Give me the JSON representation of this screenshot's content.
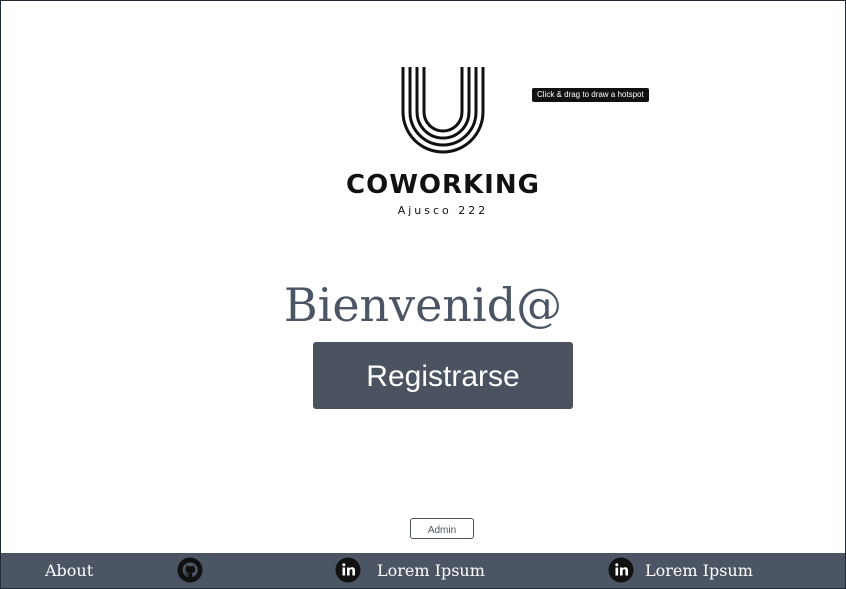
{
  "logo": {
    "word": "COWORKING",
    "subtitle": "Ajusco 222"
  },
  "tooltip": {
    "text": "Click & drag to draw a hotspot"
  },
  "main": {
    "welcome": "Bienvenid@",
    "register_label": "Registrarse",
    "admin_label": "Admin"
  },
  "footer": {
    "about_label": "About",
    "link1_label": "Lorem Ipsum",
    "link2_label": "Lorem Ipsum",
    "icons": [
      "github-icon",
      "linkedin-icon",
      "linkedin-icon"
    ],
    "background": "#4b5563"
  },
  "colors": {
    "button": "#4b5260",
    "heading": "#4b5563",
    "text_dark": "#111111"
  }
}
